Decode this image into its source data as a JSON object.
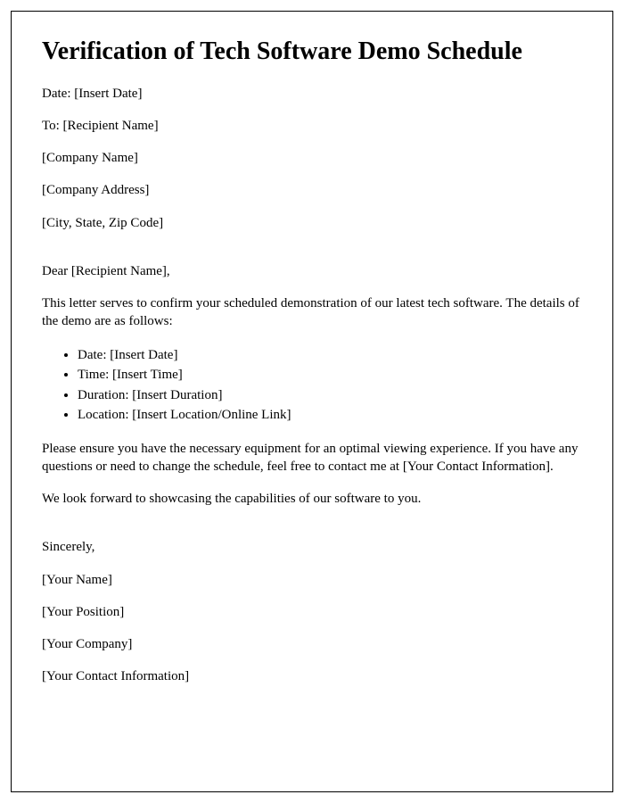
{
  "title": "Verification of Tech Software Demo Schedule",
  "header": {
    "date": "Date: [Insert Date]",
    "to": "To: [Recipient Name]",
    "company_name": "[Company Name]",
    "company_address": "[Company Address]",
    "city_state_zip": "[City, State, Zip Code]"
  },
  "salutation": "Dear [Recipient Name],",
  "intro": "This letter serves to confirm your scheduled demonstration of our latest tech software. The details of the demo are as follows:",
  "details": {
    "date": "Date: [Insert Date]",
    "time": "Time: [Insert Time]",
    "duration": "Duration: [Insert Duration]",
    "location": "Location: [Insert Location/Online Link]"
  },
  "body1": "Please ensure you have the necessary equipment for an optimal viewing experience. If you have any questions or need to change the schedule, feel free to contact me at [Your Contact Information].",
  "body2": "We look forward to showcasing the capabilities of our software to you.",
  "closing": {
    "sincerely": "Sincerely,",
    "name": "[Your Name]",
    "position": "[Your Position]",
    "company": "[Your Company]",
    "contact": "[Your Contact Information]"
  }
}
